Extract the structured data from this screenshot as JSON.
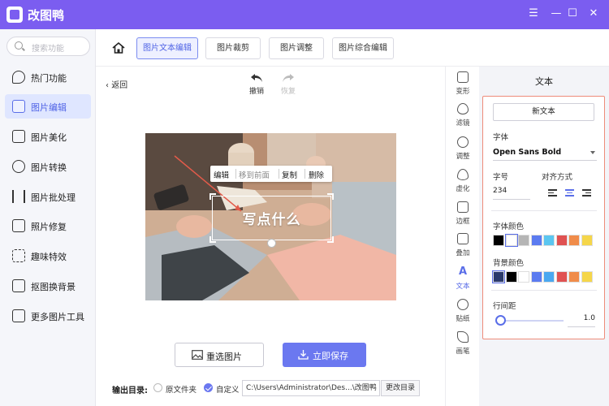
{
  "app": {
    "title": "改图鸭"
  },
  "window": {
    "menu_glyph": "☰",
    "minimize_glyph": "—",
    "maximize_glyph": "☐",
    "close_glyph": "✕"
  },
  "sidebar": {
    "search_placeholder": "搜索功能",
    "items": [
      {
        "label": "热门功能",
        "icon": "flame-icon"
      },
      {
        "label": "图片编辑",
        "icon": "image-edit-icon",
        "active": true
      },
      {
        "label": "图片美化",
        "icon": "image-beautify-icon"
      },
      {
        "label": "图片转换",
        "icon": "convert-icon"
      },
      {
        "label": "图片批处理",
        "icon": "batch-icon"
      },
      {
        "label": "照片修复",
        "icon": "repair-icon"
      },
      {
        "label": "趣味特效",
        "icon": "sparkle-icon"
      },
      {
        "label": "抠图换背景",
        "icon": "cutout-icon"
      },
      {
        "label": "更多图片工具",
        "icon": "toolbox-icon"
      }
    ]
  },
  "tabs": [
    {
      "label": "图片文本编辑",
      "active": true
    },
    {
      "label": "图片裁剪"
    },
    {
      "label": "图片调整"
    },
    {
      "label": "图片综合编辑"
    }
  ],
  "workspace": {
    "back_label": "返回",
    "undo_label": "撤销",
    "redo_label": "恢复",
    "context_menu": [
      "编辑",
      "移到前面",
      "复制",
      "删除"
    ],
    "text_box_content": "写点什么",
    "reselect_label": "重选图片",
    "save_label": "立即保存",
    "output_label": "输出目录:",
    "option_source": "原文件夹",
    "option_custom": "自定义",
    "output_path": "C:\\Users\\Administrator\\Des...\\改图鸭",
    "change_dir_label": "更改目录"
  },
  "tools": [
    {
      "label": "变形",
      "icon": "transform-icon"
    },
    {
      "label": "滤镜",
      "icon": "filter-icon"
    },
    {
      "label": "调整",
      "icon": "adjust-icon"
    },
    {
      "label": "虚化",
      "icon": "blur-icon"
    },
    {
      "label": "边框",
      "icon": "border-icon"
    },
    {
      "label": "叠加",
      "icon": "overlay-icon"
    },
    {
      "label": "文本",
      "icon": "text-icon",
      "active": true
    },
    {
      "label": "贴纸",
      "icon": "sticker-icon"
    },
    {
      "label": "画笔",
      "icon": "brush-icon"
    }
  ],
  "panel": {
    "title": "文本",
    "new_text_label": "新文本",
    "font_label": "字体",
    "font_value": "Open Sans Bold",
    "size_label": "字号",
    "size_value": "234",
    "align_label": "对齐方式",
    "font_color_label": "字体颜色",
    "bg_color_label": "背景颜色",
    "line_spacing_label": "行间距",
    "line_spacing_value": "1.0",
    "font_colors": [
      "#000000",
      "#ffffff",
      "#b5b5b5",
      "#5b7bf0",
      "#5bc6f0",
      "#e05252",
      "#f08c4a",
      "#f5d64a"
    ],
    "bg_colors": [
      "#2b3a6b",
      "#000000",
      "#ffffff",
      "#5b7bf0",
      "#4aa8f0",
      "#e05252",
      "#f08c4a",
      "#f5d64a"
    ]
  },
  "accent": "#6b78f0"
}
